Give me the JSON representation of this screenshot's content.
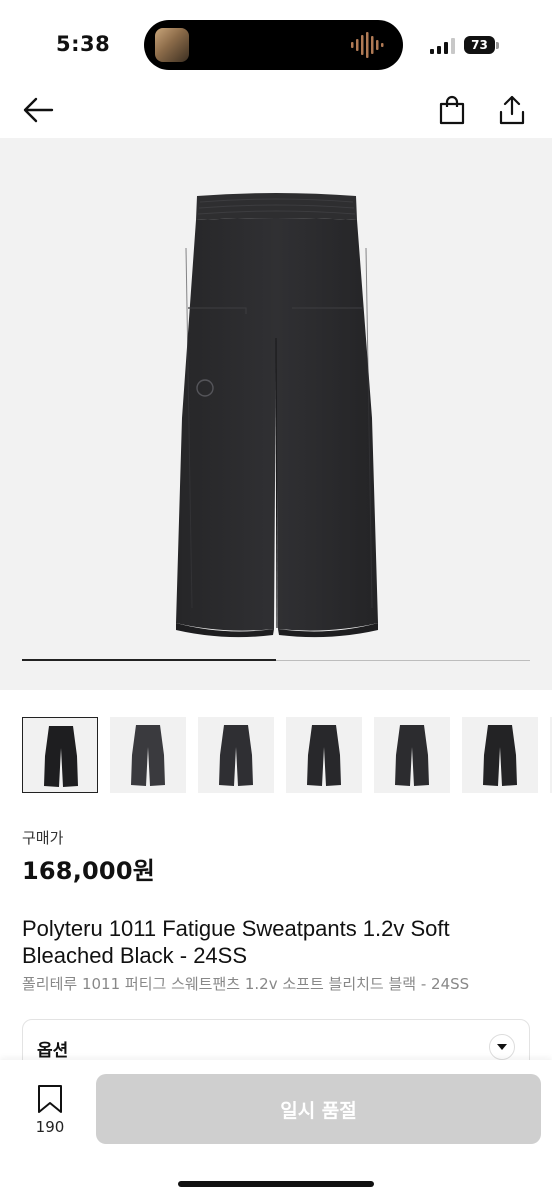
{
  "status_bar": {
    "time": "5:38",
    "battery": "73"
  },
  "nav": {
    "back_icon": "arrow-left-icon",
    "bag_icon": "shopping-bag-icon",
    "share_icon": "share-icon"
  },
  "gallery": {
    "progress": 0.5,
    "thumbnail_count": 7,
    "active_index": 0
  },
  "product": {
    "price_label": "구매가",
    "price": "168,000원",
    "title": "Polyteru 1011 Fatigue Sweatpants 1.2v Soft Bleached Black - 24SS",
    "subtitle": "폴리테루 1011 퍼티그 스웨트팬츠 1.2v 소프트 블리치드 블랙 - 24SS"
  },
  "option": {
    "label": "옵션",
    "icon": "chevron-down-icon"
  },
  "bottom_bar": {
    "wish_count": "190",
    "wish_icon": "bookmark-icon",
    "cta_label": "일시 품절"
  },
  "colors": {
    "pants": "#2b2b2d",
    "hero_bg": "#f2f2f2",
    "cta_disabled": "#cfcfcf"
  }
}
